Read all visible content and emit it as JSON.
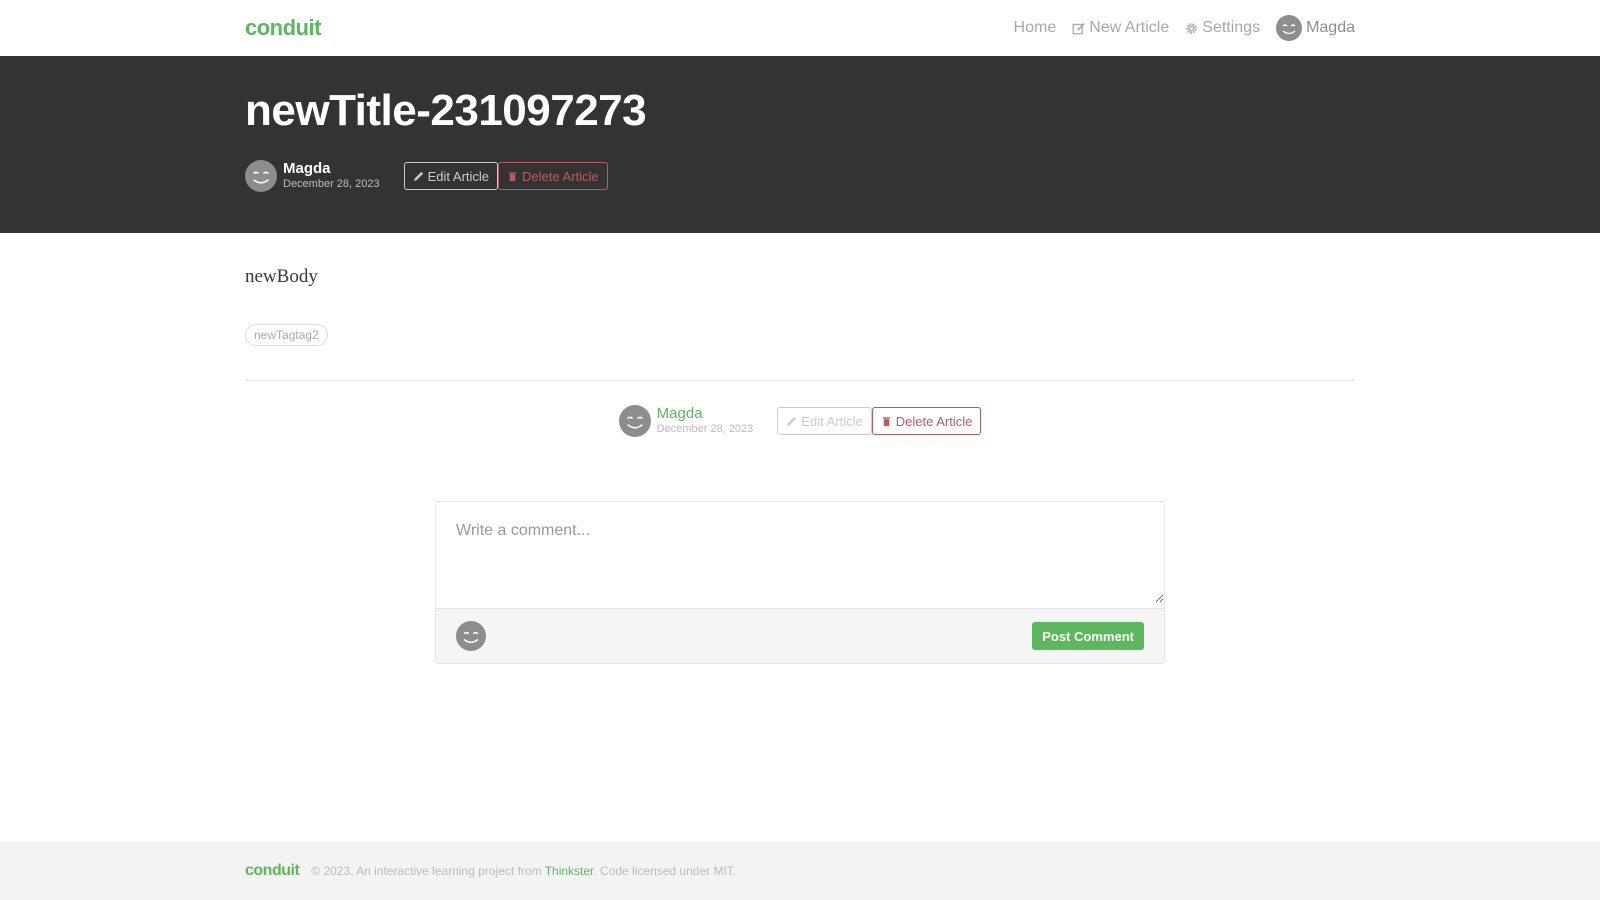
{
  "nav": {
    "brand": "conduit",
    "home": "Home",
    "new_article": "New Article",
    "settings": "Settings",
    "user": "Magda"
  },
  "article": {
    "title": "newTitle-231097273",
    "author": "Magda",
    "date": "December 28, 2023",
    "body": "newBody",
    "tags": [
      "newTagtag2"
    ]
  },
  "actions": {
    "edit_label": "Edit Article",
    "delete_label": "Delete Article"
  },
  "comment": {
    "placeholder": "Write a comment...",
    "post_label": "Post Comment"
  },
  "footer": {
    "brand": "conduit",
    "text_before": "© 2023. An interactive learning project from",
    "link": "Thinkster",
    "text_after": ". Code licensed under MIT."
  },
  "colors": {
    "brand": "#5cb85c",
    "banner": "#333333",
    "danger": "#b85c5c"
  },
  "icons": [
    "pencil-icon",
    "trash-icon",
    "gear-icon",
    "edit-square-icon",
    "smiley-avatar"
  ]
}
